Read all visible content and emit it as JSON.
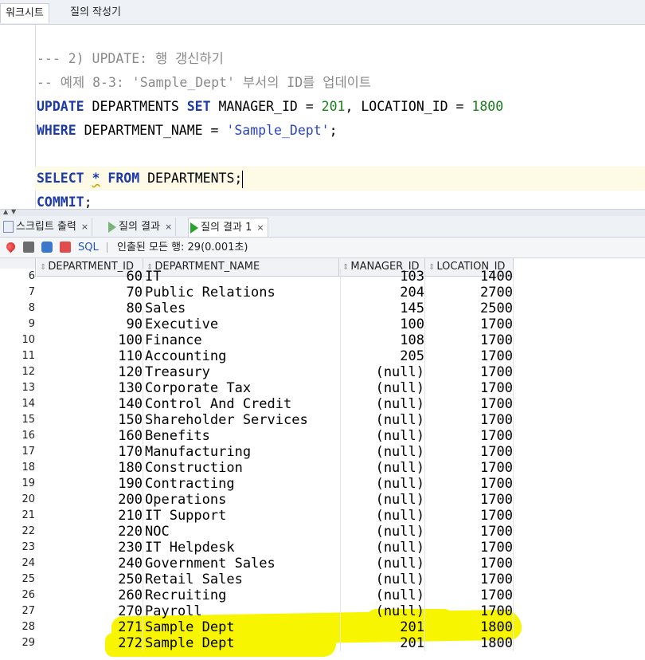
{
  "top_tabs": [
    "워크시트",
    "질의 작성기"
  ],
  "editor": {
    "lines": [
      {
        "type": "blank"
      },
      {
        "type": "comment",
        "text": "--- 2) UPDATE: 행 갱신하기"
      },
      {
        "type": "comment",
        "text": "-- 예제 8-3: 'Sample_Dept' 부서의 ID를 업데이트"
      },
      {
        "type": "update",
        "kw1": "UPDATE",
        "t1": " DEPARTMENTS ",
        "kw2": "SET",
        "t2": " MANAGER_ID = ",
        "n1": "201",
        "t3": ", LOCATION_ID = ",
        "n2": "1800"
      },
      {
        "type": "where",
        "kw1": "WHERE",
        "t1": " DEPARTMENT_NAME = ",
        "s1": "'Sample_Dept'",
        "t2": ";"
      },
      {
        "type": "blank"
      },
      {
        "type": "select",
        "kw1": "SELECT",
        "t1": " ",
        "star": "*",
        "t2": " ",
        "kw2": "FROM",
        "t3": " DEPARTMENTS;"
      },
      {
        "type": "commit",
        "kw1": "COMMIT",
        "t1": ";"
      }
    ]
  },
  "result_tabs": [
    {
      "label": "스크립트 출력",
      "close": "×"
    },
    {
      "label": "질의 결과",
      "close": "×"
    },
    {
      "label": "질의 결과 1",
      "close": "×"
    }
  ],
  "toolbar": {
    "sql_label": "SQL",
    "status": "인출된 모든 행: 29(0.001초)"
  },
  "grid": {
    "columns": [
      "DEPARTMENT_ID",
      "DEPARTMENT_NAME",
      "MANAGER_ID",
      "LOCATION_ID"
    ],
    "rows": [
      [
        "6",
        "60",
        "IT",
        "103",
        "1400"
      ],
      [
        "7",
        "70",
        "Public Relations",
        "204",
        "2700"
      ],
      [
        "8",
        "80",
        "Sales",
        "145",
        "2500"
      ],
      [
        "9",
        "90",
        "Executive",
        "100",
        "1700"
      ],
      [
        "10",
        "100",
        "Finance",
        "108",
        "1700"
      ],
      [
        "11",
        "110",
        "Accounting",
        "205",
        "1700"
      ],
      [
        "12",
        "120",
        "Treasury",
        "(null)",
        "1700"
      ],
      [
        "13",
        "130",
        "Corporate Tax",
        "(null)",
        "1700"
      ],
      [
        "14",
        "140",
        "Control And Credit",
        "(null)",
        "1700"
      ],
      [
        "15",
        "150",
        "Shareholder Services",
        "(null)",
        "1700"
      ],
      [
        "16",
        "160",
        "Benefits",
        "(null)",
        "1700"
      ],
      [
        "17",
        "170",
        "Manufacturing",
        "(null)",
        "1700"
      ],
      [
        "18",
        "180",
        "Construction",
        "(null)",
        "1700"
      ],
      [
        "19",
        "190",
        "Contracting",
        "(null)",
        "1700"
      ],
      [
        "20",
        "200",
        "Operations",
        "(null)",
        "1700"
      ],
      [
        "21",
        "210",
        "IT Support",
        "(null)",
        "1700"
      ],
      [
        "22",
        "220",
        "NOC",
        "(null)",
        "1700"
      ],
      [
        "23",
        "230",
        "IT Helpdesk",
        "(null)",
        "1700"
      ],
      [
        "24",
        "240",
        "Government Sales",
        "(null)",
        "1700"
      ],
      [
        "25",
        "250",
        "Retail Sales",
        "(null)",
        "1700"
      ],
      [
        "26",
        "260",
        "Recruiting",
        "(null)",
        "1700"
      ],
      [
        "27",
        "270",
        "Payroll",
        "(null)",
        "1700"
      ],
      [
        "28",
        "271",
        "Sample Dept",
        "201",
        "1800"
      ],
      [
        "29",
        "272",
        "Sample Dept",
        "201",
        "1800"
      ]
    ]
  },
  "colors": {
    "highlight": "#f7f500",
    "keyword": "#1c3aa8",
    "number": "#1b7f1b",
    "comment": "#8a8a8a"
  }
}
